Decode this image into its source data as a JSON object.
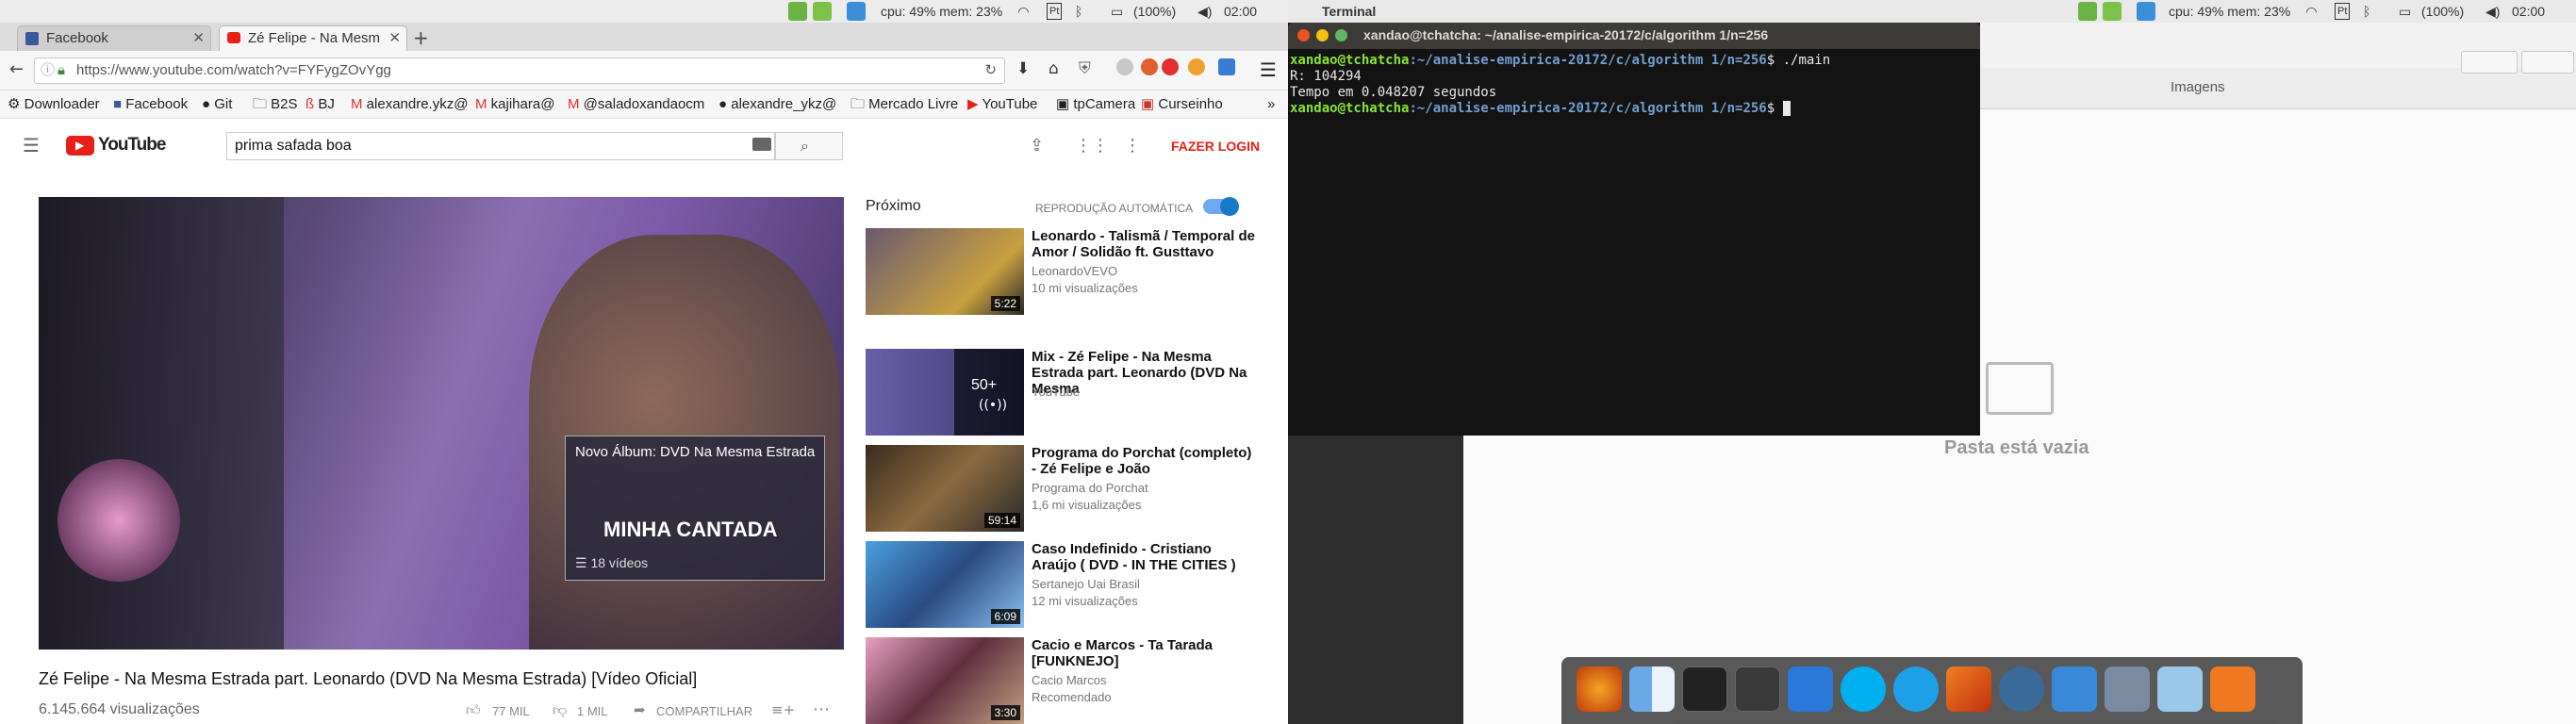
{
  "left_topbar": {
    "cpu": "cpu: 49% mem: 23%",
    "battery": "(100%)",
    "time": "02:00"
  },
  "right_topbar": {
    "app": "Terminal",
    "cpu": "cpu: 49% mem: 23%",
    "battery": "(100%)",
    "time": "02:00"
  },
  "browser": {
    "tabs": [
      {
        "label": "Facebook"
      },
      {
        "label": "Zé Felipe - Na Mesm"
      }
    ],
    "url": "https://www.youtube.com/watch?v=FYFygZOvYgg",
    "bookmarks": [
      "Downloader",
      "Facebook",
      "Git",
      "B2S",
      "BJ",
      "alexandre.ykz@",
      "kajihara@",
      "@saladoxandaocm",
      "alexandre_ykz@",
      "Mercado Livre",
      "YouTube",
      "tpCamera",
      "Curseinho"
    ],
    "overflow": "»"
  },
  "youtube": {
    "search": "prima safada boa",
    "login": "FAZER LOGIN",
    "next_label": "Próximo",
    "autoplay_label": "REPRODUÇÃO AUTOMÁTICA",
    "video_title": "Zé Felipe - Na Mesma Estrada part. Leonardo (DVD Na Mesma Estrada) [Vídeo Oficial]",
    "views": "6.145.664 visualizações",
    "likes": "77 MIL",
    "dislikes": "1 MIL",
    "share": "COMPARTILHAR",
    "overlay_title": "Novo Álbum: DVD Na Mesma Estrada",
    "overlay_big": "MINHA CANTADA",
    "overlay_videos": "18 vídeos",
    "recs": [
      {
        "title": "Leonardo - Talismã / Temporal de Amor / Solidão ft. Gusttavo",
        "channel": "LeonardoVEVO",
        "meta": "10 mi visualizações",
        "dur": "5:22"
      },
      {
        "title": "Mix - Zé Felipe - Na Mesma Estrada part. Leonardo (DVD Na Mesma",
        "channel": "YouTube",
        "meta": "",
        "dur": "50+"
      },
      {
        "title": "Programa do Porchat (completo) - Zé Felipe e João",
        "channel": "Programa do Porchat",
        "meta": "1,6 mi visualizações",
        "dur": "59:14"
      },
      {
        "title": "Caso Indefinido - Cristiano Araújo ( DVD - IN THE CITIES )",
        "channel": "Sertanejo Uai Brasil",
        "meta": "12 mi visualizações",
        "dur": "6:09"
      },
      {
        "title": "Cacio e Marcos - Ta Tarada [FUNKNEJO]",
        "channel": "Cacio Marcos",
        "meta": "Recomendado",
        "dur": "3:30"
      }
    ]
  },
  "terminal": {
    "title": "xandao@tchatcha: ~/analise-empirica-20172/c/algorithm 1/n=256",
    "prompt_user": "xandao@tchatcha",
    "prompt_path": ":~/analise-empirica-20172/c/algorithm 1/n=256",
    "cmd": "$ ./main",
    "out1": "R: 104294",
    "out2": "Tempo em 0.048207 segundos",
    "prompt_end": "$"
  },
  "files": {
    "header": "Imagens",
    "empty": "Pasta está vazia"
  }
}
